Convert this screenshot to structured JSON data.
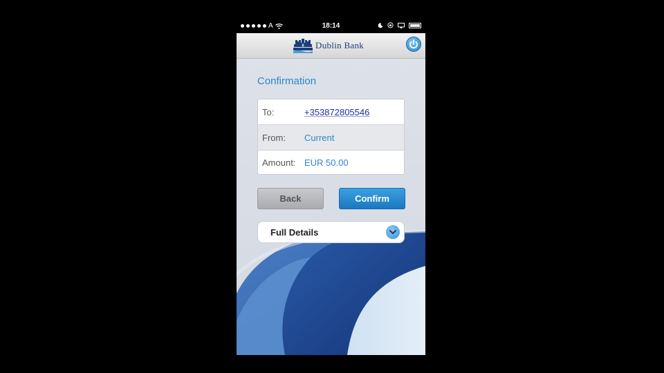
{
  "status_bar": {
    "carrier": "A",
    "time": "18:14"
  },
  "header": {
    "bank_name": "Dublin Bank"
  },
  "page": {
    "title": "Confirmation"
  },
  "summary": {
    "rows": [
      {
        "label": "To:",
        "value": "+353872805546"
      },
      {
        "label": "From:",
        "value": "Current"
      },
      {
        "label": "Amount:",
        "value": "EUR 50.00"
      }
    ]
  },
  "buttons": {
    "back": "Back",
    "confirm": "Confirm"
  },
  "details": {
    "label": "Full Details"
  },
  "colors": {
    "accent": "#2e86c8",
    "confirm": "#1c78c0",
    "link": "#1d2fa8",
    "wave_dark": "#1d3f86"
  },
  "icons": [
    "wifi-icon",
    "moon-icon",
    "lock-rotation-icon",
    "airplay-icon",
    "battery-icon",
    "castle-logo-icon",
    "power-icon",
    "chevron-down-icon"
  ]
}
